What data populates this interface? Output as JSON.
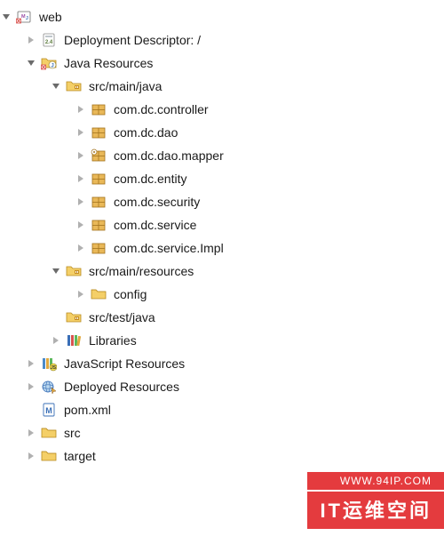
{
  "tree": {
    "web": "web",
    "deployment_descriptor": "Deployment Descriptor: /",
    "java_resources": "Java Resources",
    "src_main_java": "src/main/java",
    "pkg_controller": "com.dc.controller",
    "pkg_dao": "com.dc.dao",
    "pkg_dao_mapper": "com.dc.dao.mapper",
    "pkg_entity": "com.dc.entity",
    "pkg_security": "com.dc.security",
    "pkg_service": "com.dc.service",
    "pkg_service_impl": "com.dc.service.Impl",
    "src_main_resources": "src/main/resources",
    "config": "config",
    "src_test_java": "src/test/java",
    "libraries": "Libraries",
    "javascript_resources": "JavaScript Resources",
    "deployed_resources": "Deployed Resources",
    "pom_xml": "pom.xml",
    "src": "src",
    "target": "target"
  },
  "banner": {
    "url": "WWW.94IP.COM",
    "title": "IT运维空间"
  },
  "colors": {
    "banner_bg": "#e43b3e",
    "folder": "#e9c46a",
    "package": "#d9a441",
    "triangle": "#6b6b6b"
  }
}
